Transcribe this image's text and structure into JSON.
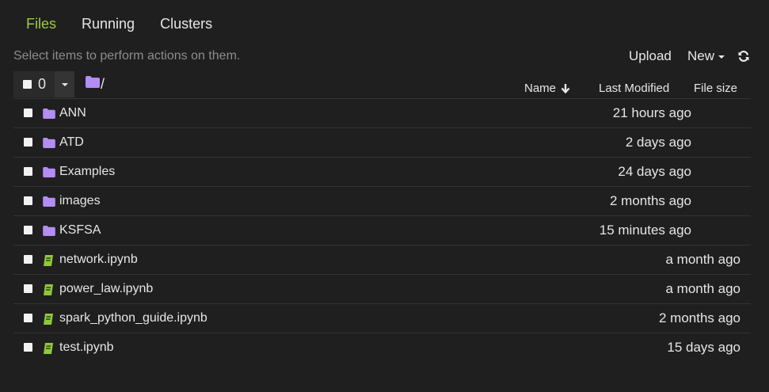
{
  "tabs": [
    {
      "label": "Files",
      "active": true
    },
    {
      "label": "Running",
      "active": false
    },
    {
      "label": "Clusters",
      "active": false
    }
  ],
  "toolbar": {
    "hint": "Select items to perform actions on them.",
    "upload_label": "Upload",
    "new_label": "New",
    "refresh_icon": "refresh-icon"
  },
  "selection": {
    "count": "0"
  },
  "breadcrumb": {
    "path": "/",
    "icon": "folder-icon"
  },
  "columns": {
    "name": "Name",
    "last_modified": "Last Modified",
    "file_size": "File size"
  },
  "colors": {
    "background": "#1f1f1f",
    "active_tab": "#9fcc3b",
    "folder_icon": "#b38df5",
    "notebook_icon": "#8fc93a"
  },
  "items": [
    {
      "type": "folder",
      "name": "ANN",
      "modified": "21 hours ago"
    },
    {
      "type": "folder",
      "name": "ATD",
      "modified": "2 days ago"
    },
    {
      "type": "folder",
      "name": "Examples",
      "modified": "24 days ago"
    },
    {
      "type": "folder",
      "name": "images",
      "modified": "2 months ago"
    },
    {
      "type": "folder",
      "name": "KSFSA",
      "modified": "15 minutes ago"
    },
    {
      "type": "notebook",
      "name": "network.ipynb",
      "modified": "a month ago"
    },
    {
      "type": "notebook",
      "name": "power_law.ipynb",
      "modified": "a month ago"
    },
    {
      "type": "notebook",
      "name": "spark_python_guide.ipynb",
      "modified": "2 months ago"
    },
    {
      "type": "notebook",
      "name": "test.ipynb",
      "modified": "15 days ago"
    }
  ]
}
